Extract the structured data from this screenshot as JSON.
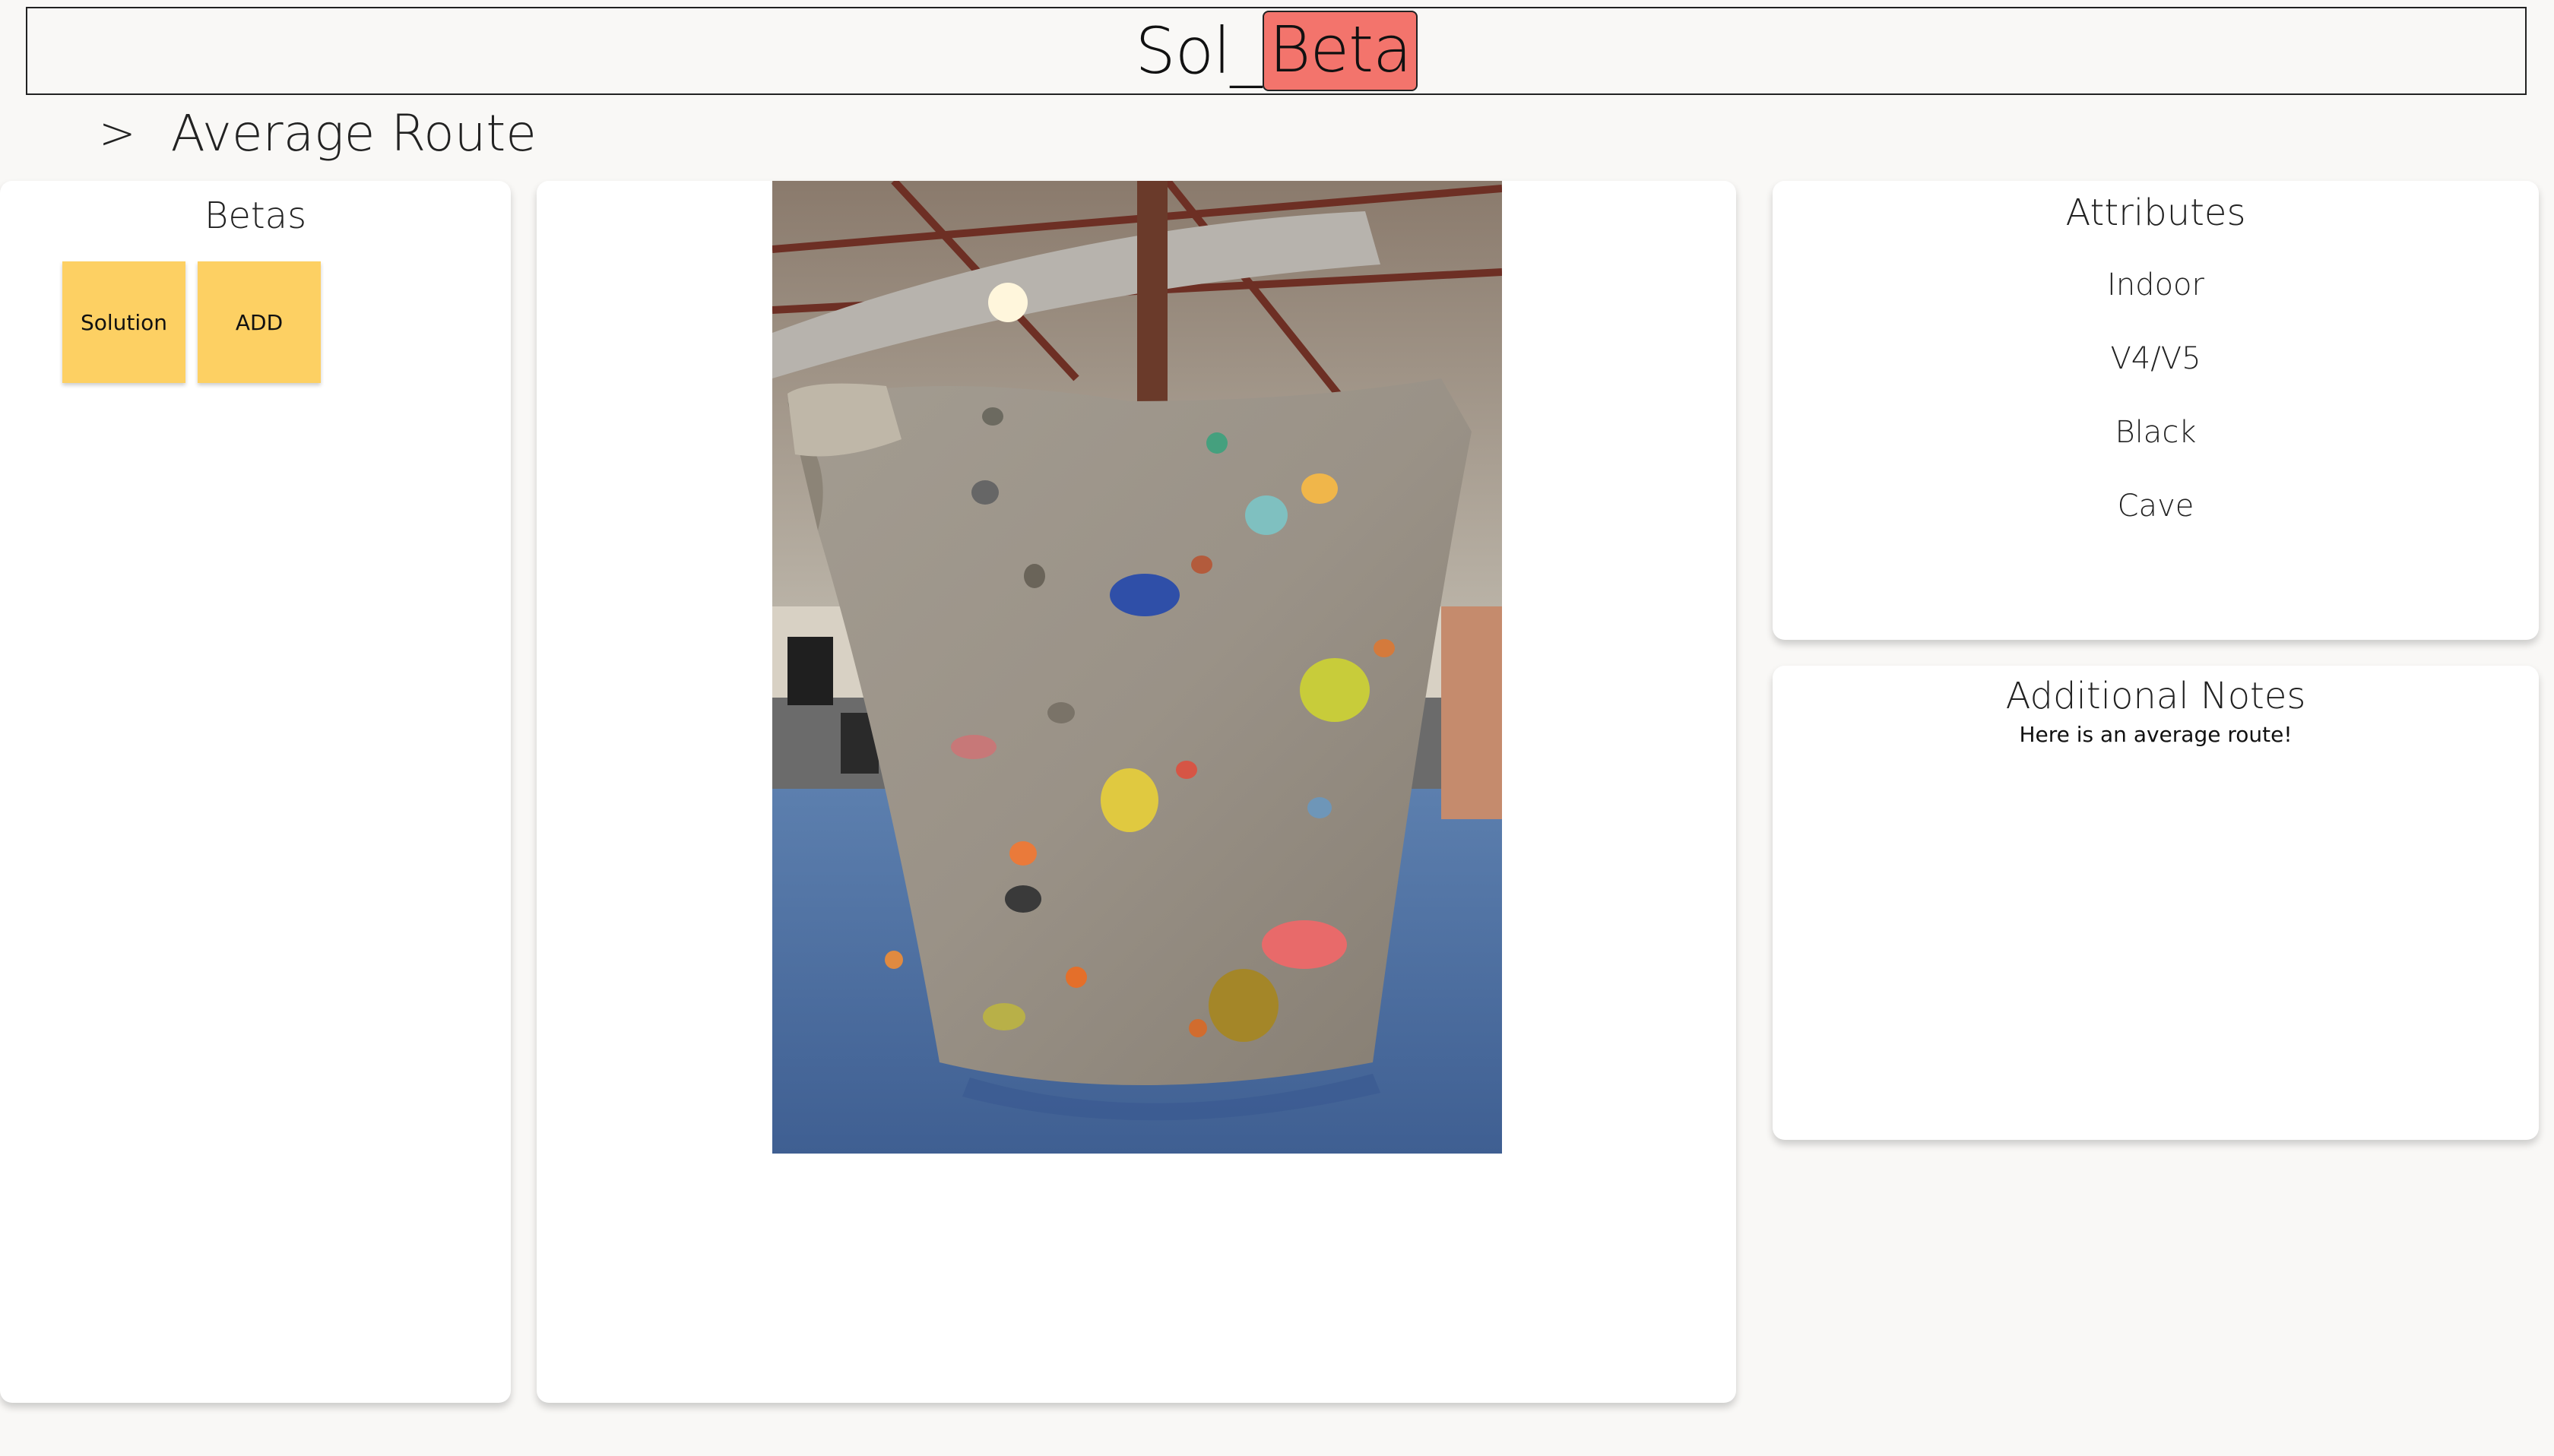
{
  "header": {
    "logo_prefix": "Sol_",
    "logo_accent": "Beta",
    "accent_color": "#f3746c"
  },
  "breadcrumb": {
    "arrow": ">",
    "title": "Average Route"
  },
  "betas": {
    "title": "Betas",
    "buttons": [
      {
        "label": "Solution"
      },
      {
        "label": "ADD"
      }
    ],
    "button_color": "#fdd063"
  },
  "route_image": {
    "subject": "indoor bouldering wall cave with colorful holds"
  },
  "attributes": {
    "title": "Attributes",
    "items": [
      "Indoor",
      "V4/V5",
      "Black",
      "Cave"
    ]
  },
  "notes": {
    "title": "Additional Notes",
    "text": "Here is an average route!"
  }
}
